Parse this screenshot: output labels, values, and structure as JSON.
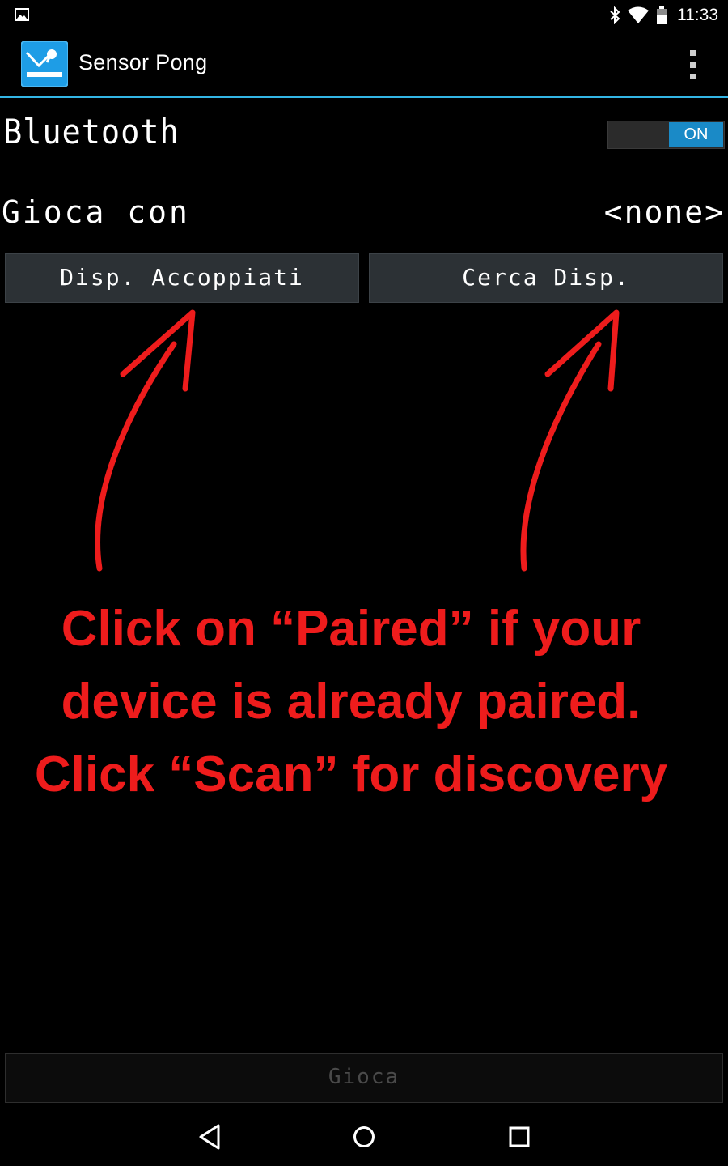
{
  "status_bar": {
    "time": "11:33",
    "icons": [
      "picture-icon",
      "bluetooth-icon",
      "wifi-icon",
      "battery-icon"
    ]
  },
  "action_bar": {
    "app_title": "Sensor Pong",
    "app_icon": "sensor-pong-app-icon",
    "overflow_icon": "overflow-menu-icon",
    "accent_color": "#33b5e5"
  },
  "bluetooth": {
    "label": "Bluetooth",
    "toggle_state": "ON",
    "toggle_color": "#1a8ac7"
  },
  "play_with": {
    "label": "Gioca con",
    "value": "<none>"
  },
  "buttons": {
    "paired_label": "Disp. Accoppiati",
    "scan_label": "Cerca Disp."
  },
  "annotation": {
    "line1": "Click on “Paired” if your",
    "line2": "device is already paired.",
    "line3": "Click “Scan” for discovery",
    "color": "#ee1c1c"
  },
  "play_button": {
    "label": "Gioca"
  },
  "nav_bar": {
    "icons": [
      "back-icon",
      "home-icon",
      "recents-icon"
    ]
  }
}
